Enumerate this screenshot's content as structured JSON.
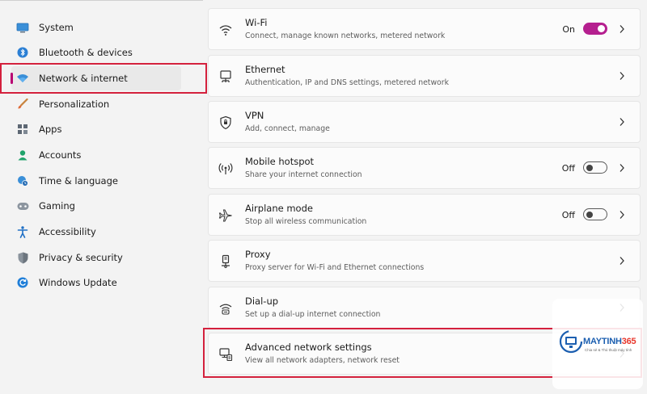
{
  "sidebar": {
    "items": [
      {
        "label": "System",
        "icon": "monitor-icon"
      },
      {
        "label": "Bluetooth & devices",
        "icon": "bluetooth-icon"
      },
      {
        "label": "Network & internet",
        "icon": "wifi-icon",
        "active": true
      },
      {
        "label": "Personalization",
        "icon": "brush-icon"
      },
      {
        "label": "Apps",
        "icon": "apps-icon"
      },
      {
        "label": "Accounts",
        "icon": "person-icon"
      },
      {
        "label": "Time & language",
        "icon": "globe-clock-icon"
      },
      {
        "label": "Gaming",
        "icon": "gamepad-icon"
      },
      {
        "label": "Accessibility",
        "icon": "accessibility-icon"
      },
      {
        "label": "Privacy & security",
        "icon": "shield-icon"
      },
      {
        "label": "Windows Update",
        "icon": "update-icon"
      }
    ]
  },
  "cards": [
    {
      "title": "Wi-Fi",
      "subtitle": "Connect, manage known networks, metered network",
      "icon": "wifi-icon",
      "state": "On",
      "toggle": "on"
    },
    {
      "title": "Ethernet",
      "subtitle": "Authentication, IP and DNS settings, metered network",
      "icon": "ethernet-icon"
    },
    {
      "title": "VPN",
      "subtitle": "Add, connect, manage",
      "icon": "vpn-shield-icon"
    },
    {
      "title": "Mobile hotspot",
      "subtitle": "Share your internet connection",
      "icon": "hotspot-icon",
      "state": "Off",
      "toggle": "off"
    },
    {
      "title": "Airplane mode",
      "subtitle": "Stop all wireless communication",
      "icon": "airplane-icon",
      "state": "Off",
      "toggle": "off"
    },
    {
      "title": "Proxy",
      "subtitle": "Proxy server for Wi-Fi and Ethernet connections",
      "icon": "proxy-icon"
    },
    {
      "title": "Dial-up",
      "subtitle": "Set up a dial-up internet connection",
      "icon": "dialup-icon"
    },
    {
      "title": "Advanced network settings",
      "subtitle": "View all network adapters, network reset",
      "icon": "network-adapter-icon"
    }
  ],
  "watermark": {
    "brand_text": "MAYTINH",
    "brand_number": "365",
    "tagline": "Chia sẻ & Thủ thuật máy tính"
  },
  "colors": {
    "accent": "#b51f8f",
    "highlight": "#d4213d",
    "watermark_blue": "#1c5fb0",
    "watermark_red": "#e8372c"
  }
}
